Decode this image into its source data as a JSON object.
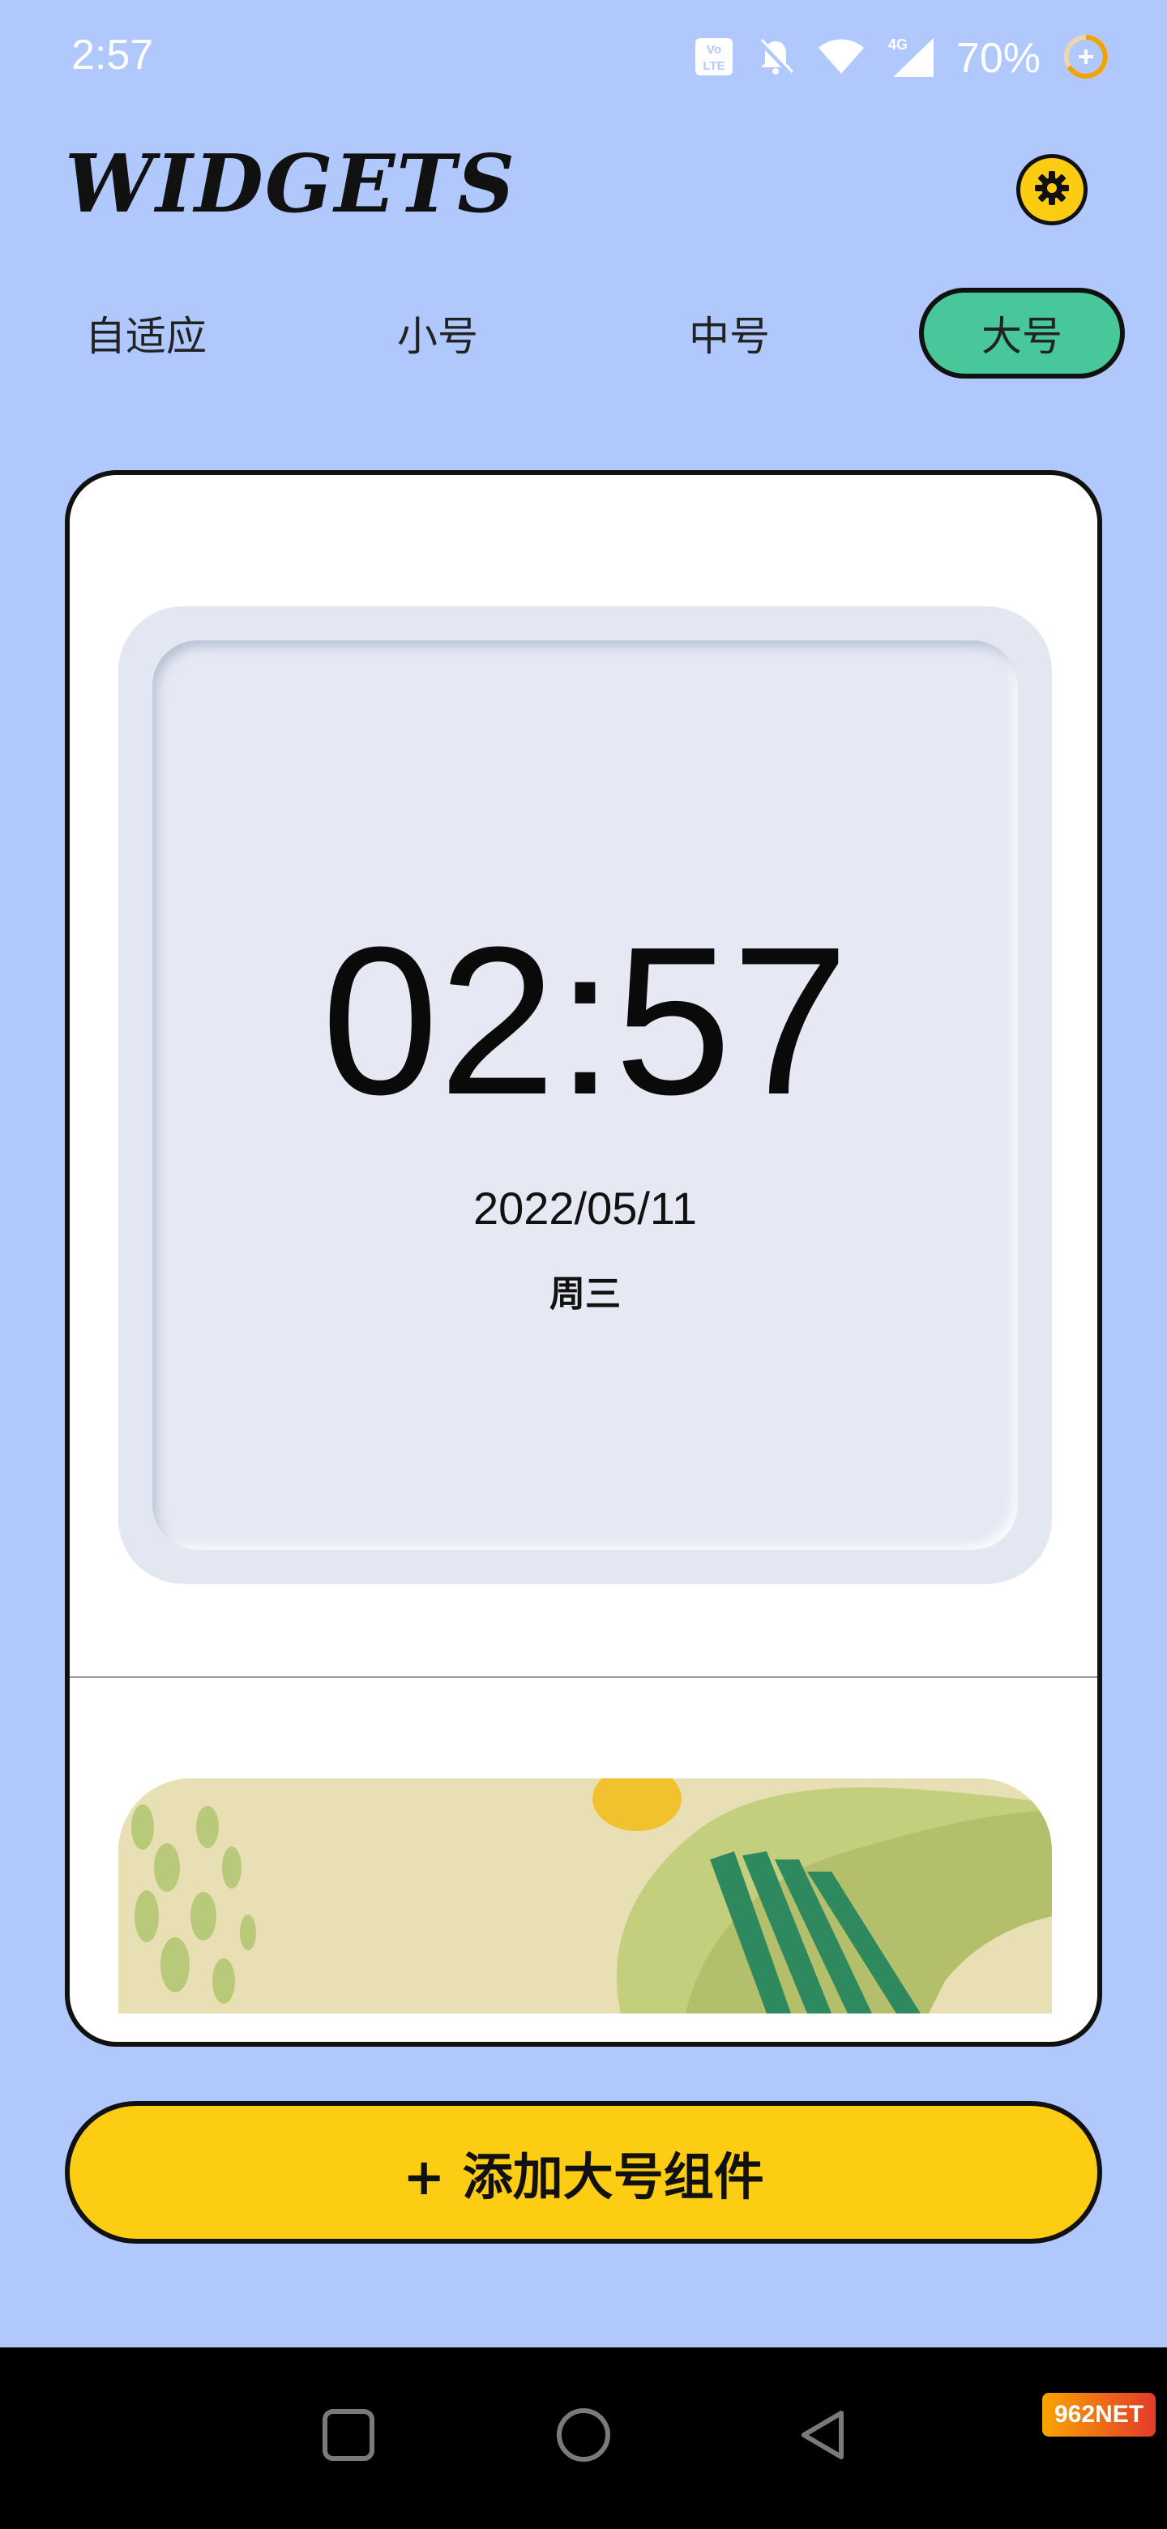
{
  "status_bar": {
    "time": "2:57",
    "icons": [
      "volte-icon",
      "bell-off-icon",
      "wifi-icon",
      "signal-4g-icon",
      "battery-saver-icon"
    ],
    "network_label": "4G",
    "volte_label": "VoLTE",
    "battery_percent": "70%"
  },
  "header": {
    "title": "WIDGETS",
    "settings_icon": "gear-icon"
  },
  "tabs": [
    {
      "label": "自适应",
      "active": false
    },
    {
      "label": "小号",
      "active": false
    },
    {
      "label": "中号",
      "active": false
    },
    {
      "label": "大号",
      "active": true
    }
  ],
  "widget_preview": {
    "time": "02:57",
    "date": "2022/05/11",
    "weekday": "周三"
  },
  "add_button": {
    "label": "+ 添加大号组件"
  },
  "nav_bar": {
    "buttons": [
      "recents-square-icon",
      "home-circle-icon",
      "back-triangle-icon"
    ]
  },
  "watermark": {
    "text": "962NET"
  },
  "colors": {
    "background": "#b0c8fc",
    "accent_yellow": "#fdcd13",
    "active_tab": "#48c79a",
    "card": "#ffffff",
    "clock_face": "#e6e8f3"
  }
}
